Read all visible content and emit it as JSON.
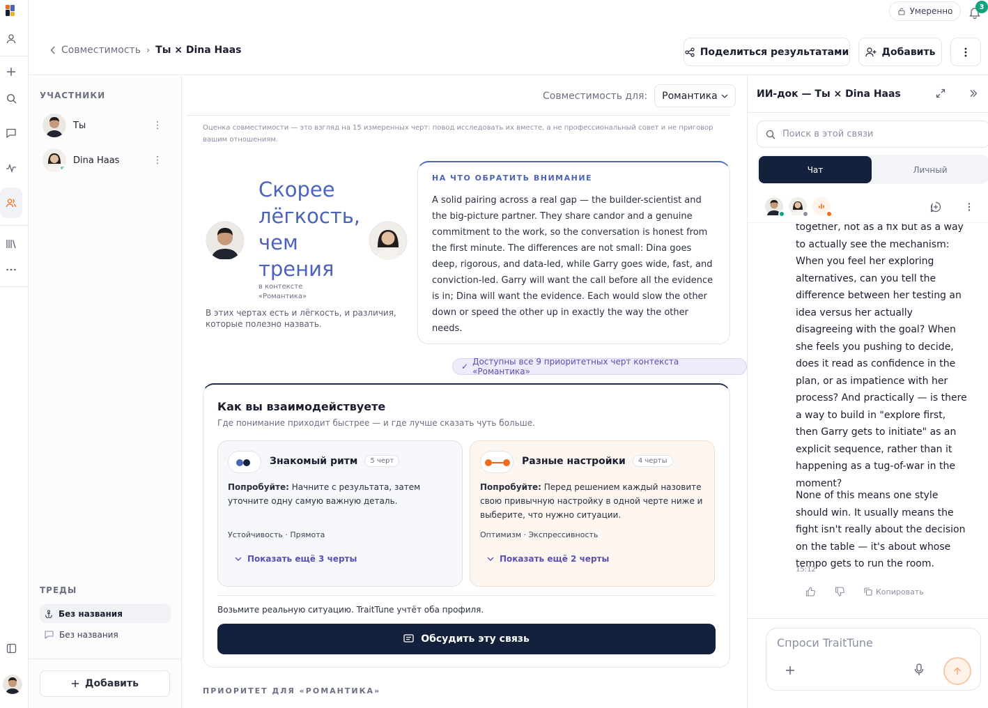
{
  "header": {
    "mode_label": "Умеренно",
    "notification_count": "3",
    "breadcrumb_parent": "Совместимость",
    "breadcrumb_current": "Ты × Dina Haas",
    "share_label": "Поделиться результатами",
    "add_label": "Добавить"
  },
  "participants": {
    "heading": "УЧАСТНИКИ",
    "items": [
      {
        "name": "Ты"
      },
      {
        "name": "Dina Haas"
      }
    ]
  },
  "threads": {
    "heading": "ТРЕДЫ",
    "items": [
      {
        "label": "Без названия"
      },
      {
        "label": "Без названия"
      }
    ],
    "add_label": "Добавить"
  },
  "main": {
    "compat_label": "Совместимость для:",
    "compat_value": "Романтика",
    "disclaimer": "Оценка совместимости — это взгляд на 15 измеренных черт: повод исследовать их вместе, а не профессиональный совет и не приговор вашим отношениям.",
    "hero_title": "Скорее лёгкость, чем трения",
    "hero_context": "в контексте «Романтика»",
    "hero_sub": "В этих чертах есть и лёгкость, и различия, которые полезно назвать.",
    "notice_heading": "НА ЧТО ОБРАТИТЬ ВНИМАНИЕ",
    "notice_text": "A solid pairing across a real gap — the builder-scientist and the big-picture partner. They share candor and a genuine commitment to the work, so the conversation is honest from the first minute. The differences are not small: Dina goes deep, rigorous, and data-led, while Garry goes wide, fast, and conviction-led. Garry will want the call before all the evidence is in; Dina will want the evidence. Each would slow the other down or speed the other up in exactly the way the other needs.",
    "available_tag": "Доступны все 9 приоритетных черт контекста «Романтика»",
    "interact_title": "Как вы взаимодействуете",
    "interact_sub": "Где понимание приходит быстрее — и где лучше сказать чуть больше.",
    "cards": [
      {
        "title": "Знакомый ритм",
        "count": "5 черт",
        "try_label": "Попробуйте:",
        "try_text": "Начните с результата, затем уточните одну самую важную деталь.",
        "traits": "Устойчивость · Прямота",
        "more": "Показать ещё 3 черты"
      },
      {
        "title": "Разные настройки",
        "count": "4 черты",
        "try_label": "Попробуйте:",
        "try_text": "Перед решением каждый назовите свою привычную настройку в одной черте ниже и выберите, что нужно ситуации.",
        "traits": "Оптимизм · Экспрессивность",
        "more": "Показать ещё 2 черты"
      }
    ],
    "take_text": "Возьмите реальную ситуацию. TraitTune учтёт оба профиля.",
    "discuss_label": "Обсудить эту связь",
    "priority_heading": "ПРИОРИТЕТ ДЛЯ «РОМАНТИКА»"
  },
  "ai": {
    "title": "ИИ-док — Ты × Dina Haas",
    "search_placeholder": "Поиск в этой связи",
    "tab_chat": "Чат",
    "tab_personal": "Личный",
    "message_1": "together, not as a fix but as a way to actually see the mechanism: When you feel her exploring alternatives, can you tell the difference between her testing an idea versus her actually disagreeing with the goal? When she feels you pushing to decide, does it read as confidence in the plan, or as impatience with her process? And practically — is there a way to build in \"explore first, then Garry gets to initiate\" as an explicit sequence, rather than it happening as a tug-of-war in the moment?",
    "message_2": "None of this means one style should win. It usually means the fight isn't really about the decision on the table — it's about whose tempo gets to run the room.",
    "time": "15:12",
    "copy_label": "Копировать",
    "composer_placeholder": "Спроси TraitTune"
  },
  "colors": {
    "accent": "#4b63b8",
    "navy": "#14213d",
    "orange": "#f26a1b",
    "green": "#12a37e"
  }
}
